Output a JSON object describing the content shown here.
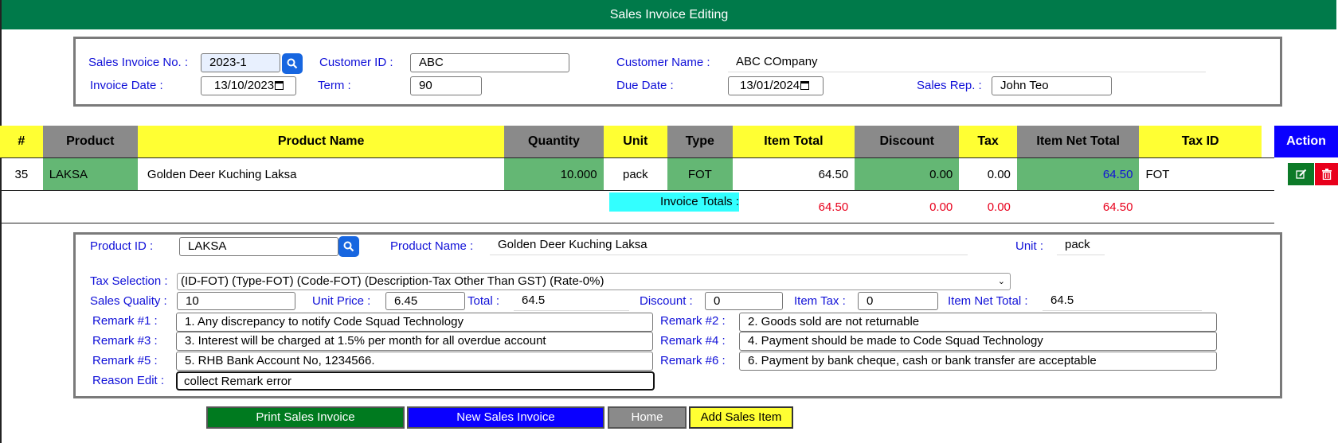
{
  "header": {
    "title": "Sales Invoice Editing"
  },
  "invoice": {
    "no_label": "Sales Invoice No. :",
    "no_value": "2023-1",
    "customer_id_label": "Customer ID :",
    "customer_id_value": "ABC",
    "customer_name_label": "Customer Name :",
    "customer_name_value": "ABC COmpany",
    "date_label": "Invoice Date :",
    "date_value": "13/10/2023",
    "term_label": "Term :",
    "term_value": "90",
    "due_label": "Due Date :",
    "due_value": "13/01/2024",
    "rep_label": "Sales Rep. :",
    "rep_value": "John Teo"
  },
  "table": {
    "headers": [
      "#",
      "Product",
      "Product Name",
      "Quantity",
      "Unit",
      "Type",
      "Item Total",
      "Discount",
      "Tax",
      "Item Net Total",
      "Tax ID",
      "Action"
    ],
    "rows": [
      {
        "num": "35",
        "product": "LAKSA",
        "name": "Golden Deer Kuching Laksa",
        "qty": "10.000",
        "unit": "pack",
        "type": "FOT",
        "item_total": "64.50",
        "discount": "0.00",
        "tax": "0.00",
        "net_total": "64.50",
        "tax_id": "FOT"
      }
    ],
    "totals": {
      "label": "Invoice Totals :",
      "item_total": "64.50",
      "discount": "0.00",
      "tax": "0.00",
      "net_total": "64.50"
    }
  },
  "item": {
    "product_id_label": "Product ID :",
    "product_id_value": "LAKSA",
    "product_name_label": "Product Name :",
    "product_name_value": "Golden Deer Kuching Laksa",
    "unit_label": "Unit :",
    "unit_value": "pack",
    "tax_label": "Tax Selection :",
    "tax_value": "(ID-FOT) (Type-FOT) (Code-FOT) (Description-Tax Other Than GST) (Rate-0%)",
    "qty_label": "Sales Quality :",
    "qty_value": "10",
    "price_label": "Unit Price :",
    "price_value": "6.45",
    "total_label": "Total :",
    "total_value": "64.5",
    "discount_label": "Discount :",
    "discount_value": "0",
    "itemtax_label": "Item Tax :",
    "itemtax_value": "0",
    "net_label": "Item Net Total :",
    "net_value": "64.5",
    "remarks": [
      {
        "label": "Remark #1 :",
        "value": "1. Any discrepancy to notify Code Squad Technology"
      },
      {
        "label": "Remark #2 :",
        "value": "2. Goods sold are not returnable"
      },
      {
        "label": "Remark #3 :",
        "value": "3. Interest will be charged at 1.5% per month for all overdue account"
      },
      {
        "label": "Remark #4 :",
        "value": "4. Payment should be made to Code Squad Technology"
      },
      {
        "label": "Remark #5 :",
        "value": "5. RHB Bank Account No, 1234566."
      },
      {
        "label": "Remark #6 :",
        "value": "6. Payment by bank cheque, cash or bank transfer are acceptable"
      }
    ],
    "reason_label": "Reason Edit :",
    "reason_value": "collect Remark error"
  },
  "buttons": {
    "print": "Print Sales Invoice",
    "new": "New Sales Invoice",
    "home": "Home",
    "add": "Add Sales Item"
  },
  "colors": {
    "header_bg": "#007a4a",
    "label": "#1010d8",
    "total_red": "#e8001c",
    "search_btn": "#1766e0"
  }
}
